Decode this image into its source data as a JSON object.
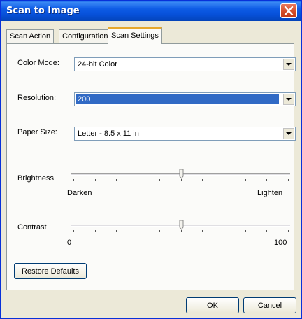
{
  "window": {
    "title": "Scan to Image"
  },
  "tabs": [
    {
      "label": "Scan Action",
      "active": false
    },
    {
      "label": "Configuration",
      "active": false
    },
    {
      "label": "Scan Settings",
      "active": true
    }
  ],
  "color_mode": {
    "label": "Color Mode:",
    "value": "24-bit Color"
  },
  "resolution": {
    "label": "Resolution:",
    "value": "200"
  },
  "paper_size": {
    "label": "Paper Size:",
    "value": "Letter - 8.5  x 11 in"
  },
  "brightness": {
    "label": "Brightness",
    "min_label": "Darken",
    "max_label": "Lighten",
    "level": 0.5
  },
  "contrast": {
    "label": "Contrast",
    "min_label": "0",
    "max_label": "100",
    "level": 0.5
  },
  "restore_defaults_label": "Restore Defaults",
  "ok_label": "OK",
  "cancel_label": "Cancel",
  "colors": {
    "titlebar": "#0a5ae4",
    "selection": "#316ac5",
    "tab_highlight": "#e6a82d"
  },
  "icons": {
    "close": "close-icon",
    "dropdown": "chevron-down-icon"
  }
}
